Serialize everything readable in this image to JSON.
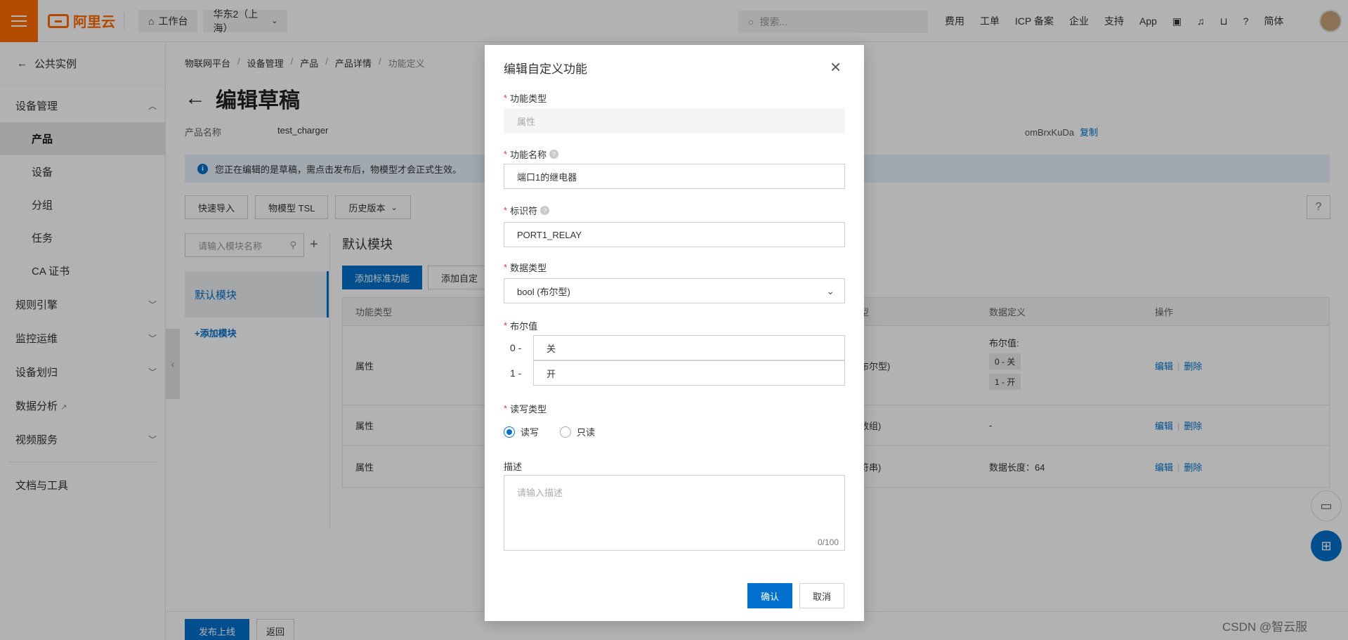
{
  "topbar": {
    "brand": "阿里云",
    "workbench": "工作台",
    "region": "华东2（上海）",
    "search_placeholder": "搜索...",
    "links": [
      "费用",
      "工单",
      "ICP 备案",
      "企业",
      "支持",
      "App"
    ],
    "lang": "简体"
  },
  "sidebar": {
    "back_label": "公共实例",
    "group_device": "设备管理",
    "items": [
      "产品",
      "设备",
      "分组",
      "任务",
      "CA 证书"
    ],
    "groups": [
      "规则引擎",
      "监控运维",
      "设备划归",
      "数据分析",
      "视频服务"
    ],
    "docs": "文档与工具"
  },
  "main": {
    "breadcrumb": [
      "物联网平台",
      "设备管理",
      "产品",
      "产品详情",
      "功能定义"
    ],
    "title": "编辑草稿",
    "product_name_label": "产品名称",
    "product_name_value": "test_charger",
    "product_key_fragment": "omBrxKuDa",
    "copy_label": "复制",
    "alert_text": "您正在编辑的是草稿，需点击发布后，物模型才会正式生效。",
    "toolbar": [
      "快速导入",
      "物模型 TSL",
      "历史版本"
    ],
    "help": "?",
    "module_search_placeholder": "请输入模块名称",
    "module_default": "默认模块",
    "module_add": "+添加模块",
    "section_title": "默认模块",
    "add_standard": "添加标准功能",
    "add_custom": "添加自定",
    "table_headers": {
      "type": "功能类型",
      "datatype_frag": "型",
      "definition": "数据定义",
      "ops": "操作"
    },
    "rows": [
      {
        "type": "属性",
        "datatype_frag": "布尔型)",
        "definition_label": "布尔值:",
        "tags": [
          "0 - 关",
          "1 - 开"
        ],
        "edit": "编辑",
        "delete": "删除"
      },
      {
        "type": "属性",
        "datatype_frag": "数组)",
        "definition": "-",
        "edit": "编辑",
        "delete": "删除"
      },
      {
        "type": "属性",
        "datatype_frag": "符串)",
        "definition": "数据长度：64",
        "edit": "编辑",
        "delete": "删除"
      }
    ],
    "publish": "发布上线",
    "return": "返回"
  },
  "modal": {
    "title": "编辑自定义功能",
    "type_label": "功能类型",
    "type_value": "属性",
    "name_label": "功能名称",
    "name_value": "端口1的继电器",
    "identifier_label": "标识符",
    "identifier_value": "PORT1_RELAY",
    "datatype_label": "数据类型",
    "datatype_value": "bool (布尔型)",
    "bool_label": "布尔值",
    "bool_0_prefix": "0 -",
    "bool_0_value": "关",
    "bool_1_prefix": "1 -",
    "bool_1_value": "开",
    "rw_label": "读写类型",
    "rw_options": [
      "读写",
      "只读"
    ],
    "rw_selected": "读写",
    "desc_label": "描述",
    "desc_placeholder": "请输入描述",
    "desc_counter": "0/100",
    "ok": "确认",
    "cancel": "取消"
  },
  "watermark": "CSDN @智云服",
  "colors": {
    "brand_orange": "#ff6a00",
    "primary_blue": "#0070cc",
    "required_red": "#e4393c"
  }
}
